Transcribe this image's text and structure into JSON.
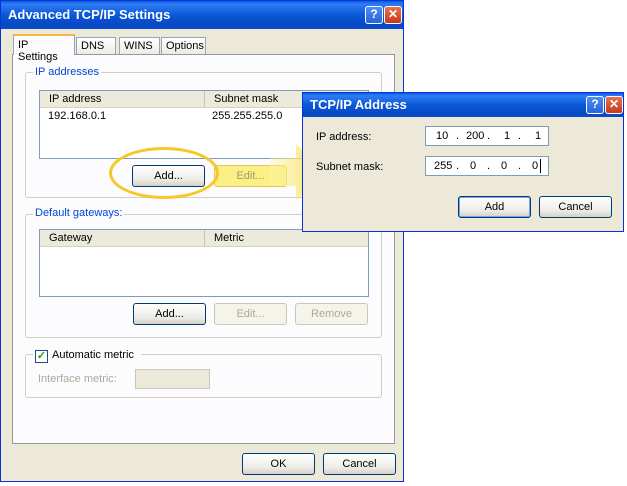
{
  "main_window": {
    "title": "Advanced TCP/IP Settings",
    "tabs": [
      "IP Settings",
      "DNS",
      "WINS",
      "Options"
    ],
    "ip_group": {
      "label": "IP addresses",
      "columns": [
        "IP address",
        "Subnet mask"
      ],
      "rows": [
        {
          "ip": "192.168.0.1",
          "mask": "255.255.255.0"
        }
      ],
      "add_label": "Add...",
      "edit_label": "Edit..."
    },
    "gateway_group": {
      "label": "Default gateways:",
      "columns": [
        "Gateway",
        "Metric"
      ],
      "add_label": "Add...",
      "edit_label": "Edit...",
      "remove_label": "Remove"
    },
    "metric": {
      "checkbox_label": "Automatic metric",
      "checked": true,
      "interface_label": "Interface metric:"
    },
    "ok_label": "OK",
    "cancel_label": "Cancel",
    "help_glyph": "?",
    "close_glyph": "✕"
  },
  "ip_dialog": {
    "title": "TCP/IP Address",
    "ip_label": "IP address:",
    "ip_octets": [
      "10",
      "200",
      "1",
      "1"
    ],
    "mask_label": "Subnet mask:",
    "mask_octets": [
      "255",
      "0",
      "0",
      "0"
    ],
    "add_label": "Add",
    "cancel_label": "Cancel",
    "help_glyph": "?",
    "close_glyph": "✕"
  },
  "colors": {
    "titlebar": "#0a58d6",
    "highlight": "#f6c828",
    "highlight_fill": "#fbf08a",
    "dialog_bg": "#ece9d8"
  }
}
